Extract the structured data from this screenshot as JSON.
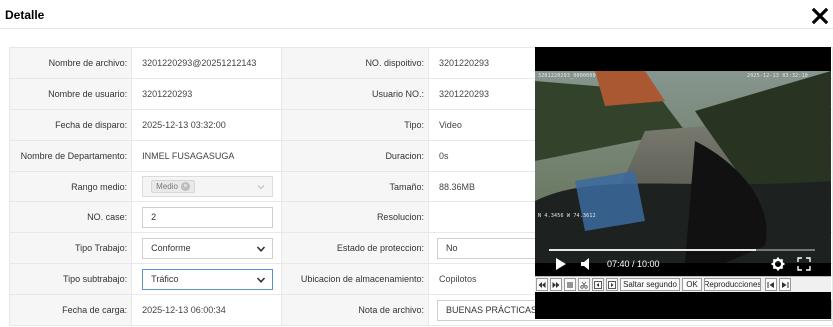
{
  "window": {
    "title": "Detalle"
  },
  "rows": [
    {
      "left_label": "Nombre de archivo:",
      "left_value": "3201220293@20251212143",
      "right_label": "NO. dispoitivo:",
      "right_value": "3201220293"
    },
    {
      "left_label": "Nombre de usuario:",
      "left_value": "3201220293",
      "right_label": "Usuario NO.:",
      "right_value": "3201220293"
    },
    {
      "left_label": "Fecha de disparo:",
      "left_value": "2025-12-13 03:32:00",
      "right_label": "Tipo:",
      "right_value": "Video"
    },
    {
      "left_label": "Nombre de Departamento:",
      "left_value": "INMEL FUSAGASUGA",
      "right_label": "Duracion:",
      "right_value": "0s"
    },
    {
      "left_label": "Rango medio:",
      "left_value": "Medio",
      "right_label": "Tamaño:",
      "right_value": "88.36MB"
    },
    {
      "left_label": "NO. case:",
      "left_value": "2",
      "right_label": "Resolucion:",
      "right_value": ""
    },
    {
      "left_label": "Tipo Trabajo:",
      "left_value": "Conforme",
      "right_label": "Estado de proteccion:",
      "right_value": "No"
    },
    {
      "left_label": "Tipo subtrabajo:",
      "left_value": "Tráfico",
      "right_label": "Ubicacion de almacenamiento:",
      "right_value": "Copilotos"
    },
    {
      "left_label": "Fecha de carga:",
      "left_value": "2025-12-13 06:00:34",
      "right_label": "Nota de archivo:",
      "right_value": "BUENAS PRÁCTICAS DE CONDUCCIÓN - diego ortega"
    }
  ],
  "player": {
    "time": "07:40 / 10:00",
    "progress": 0.78,
    "osd_top_left": "3201220293_0000000",
    "osd_top_right": "2025-12-13 03:32:10",
    "osd_bottom_left": "N 4.3456  W 74.3612",
    "toolbar": {
      "skip_label": "Saltar segundo",
      "ok_label": "OK",
      "playback_label": "Reproducciones"
    }
  },
  "colors": {
    "label_bg": "#f6f6f6",
    "border": "#e8e8e8",
    "focus_border": "#5b8fd6"
  }
}
